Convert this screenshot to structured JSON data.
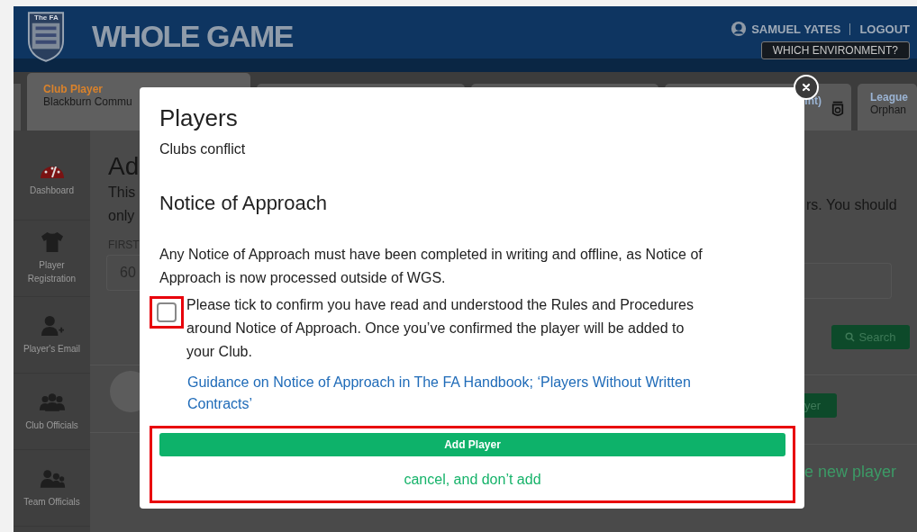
{
  "header": {
    "logo_text": "The FA",
    "title": "WHOLE GAME",
    "user": "SAMUEL YATES",
    "logout": "LOGOUT",
    "environment_button": "WHICH ENVIRONMENT?"
  },
  "tabs": [
    {
      "title": "Club Player",
      "subtitle": "Blackburn Commu",
      "selected": true
    },
    {
      "selected": false
    },
    {
      "selected": false
    },
    {
      "title": "int)",
      "selected": false
    },
    {
      "title": "League",
      "subtitle": "Orphan",
      "selected": false
    }
  ],
  "sidebar": {
    "items": [
      {
        "label": "Dashboard",
        "kind": "gauge"
      },
      {
        "label": "Player Registration",
        "kind": "shirt"
      },
      {
        "label": "Player's Email",
        "kind": "person-add"
      },
      {
        "label": "Club Officials",
        "kind": "group"
      },
      {
        "label": "Team Officials",
        "kind": "team"
      }
    ]
  },
  "page": {
    "heading": "Ad",
    "intro_lines": [
      "This",
      "only"
    ],
    "intro_right": "rs. You should",
    "field_label": "FIRST",
    "field_value": "60",
    "search_button": "Search",
    "add_button": "yer",
    "create_link": "e new player"
  },
  "modal": {
    "title": "Players",
    "subtitle": "Clubs conflict",
    "section_title": "Notice of Approach",
    "notice": "Any Notice of Approach must have been completed in writing and offline, as Notice of Approach is now processed outside of WGS.",
    "confirm": {
      "checked": false,
      "label": "Please tick to confirm you have read and understood the Rules and Procedures around Notice of Approach. Once you’ve confirmed the player will be added to your Club."
    },
    "guidance_link": "Guidance on Notice of Approach in The FA Handbook; ‘Players Without Written Contracts’",
    "add_button": "Add Player",
    "cancel_link": "cancel, and don’t add"
  }
}
